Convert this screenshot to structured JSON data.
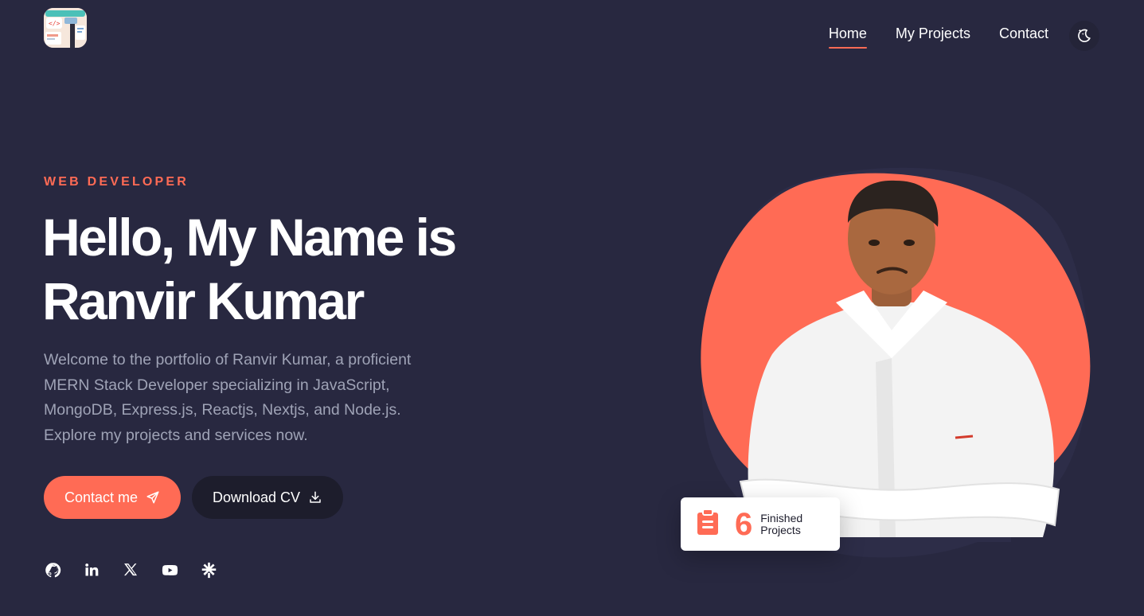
{
  "nav": {
    "items": [
      {
        "label": "Home",
        "active": true
      },
      {
        "label": "My Projects",
        "active": false
      },
      {
        "label": "Contact",
        "active": false
      }
    ],
    "theme_toggle_icon": "moon-stars-icon"
  },
  "hero": {
    "subtitle": "WEB DEVELOPER",
    "headline_line1": "Hello, My Name is",
    "headline_line2": "Ranvir Kumar",
    "intro": "Welcome to the portfolio of Ranvir Kumar, a proficient MERN Stack Developer specializing in JavaScript, MongoDB, Express.js, Reactjs, Nextjs, and Node.js. Explore my projects and services now.",
    "contact_button": "Contact me",
    "contact_button_icon": "send-icon",
    "cv_button": "Download CV",
    "cv_button_icon": "download-icon"
  },
  "socials": [
    "github-icon",
    "linkedin-icon",
    "x-icon",
    "youtube-icon",
    "linktree-icon"
  ],
  "stats": {
    "number": "6",
    "label": "Finished Projects",
    "icon": "clipboard-icon"
  },
  "colors": {
    "background": "#282840",
    "accent": "#ff6b55",
    "muted_text": "#9fa3b6",
    "dark_button": "#1d1d2c"
  }
}
